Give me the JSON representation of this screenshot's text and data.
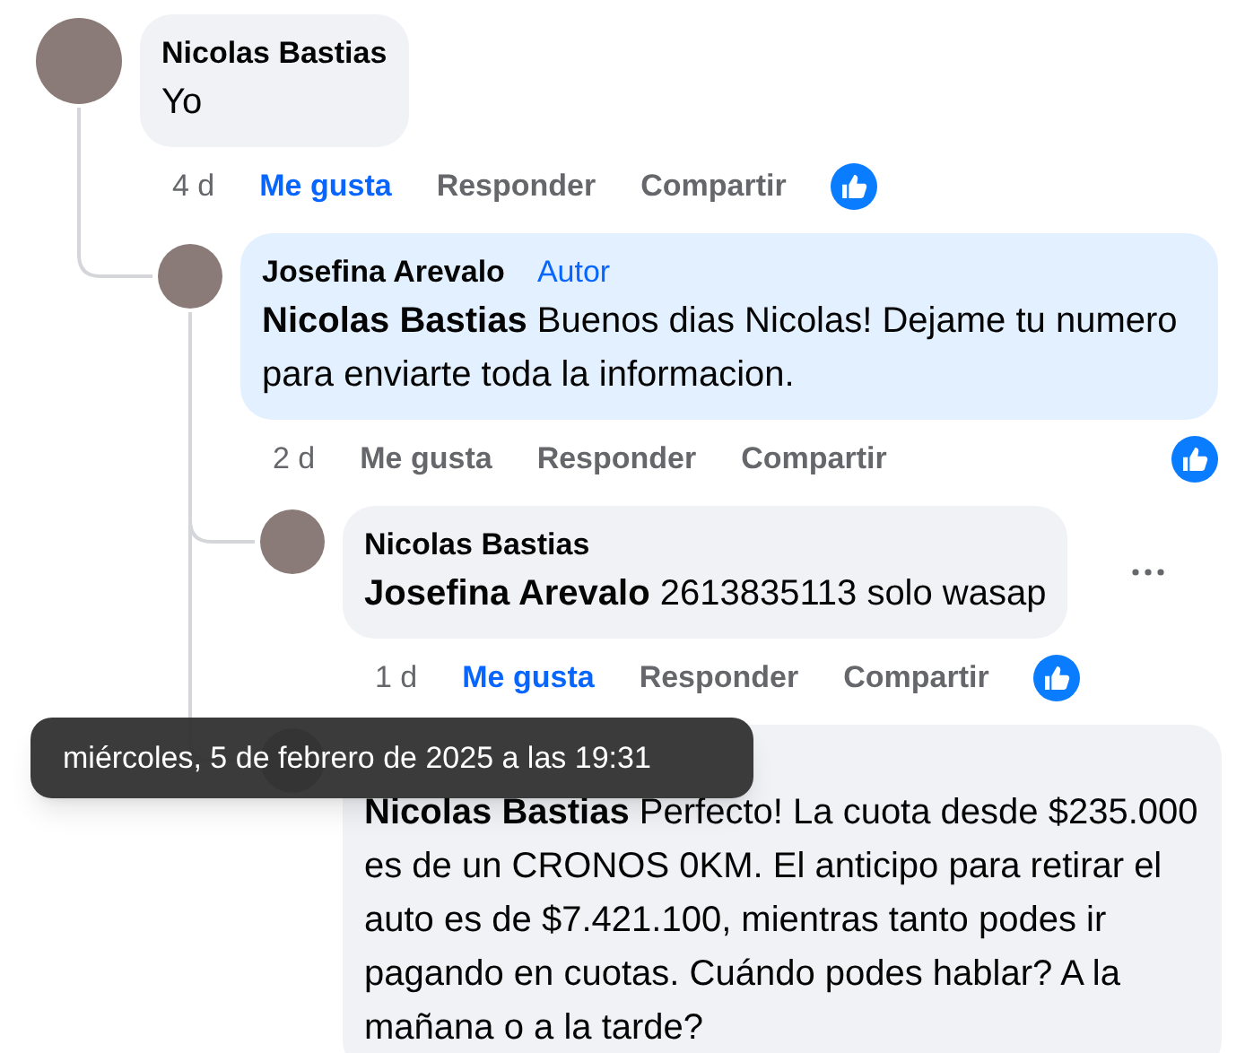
{
  "comments": [
    {
      "author": "Nicolas Bastias",
      "text": "Yo",
      "highlighted": false,
      "time": "4 d",
      "like": "Me gusta",
      "liked": true,
      "reply": "Responder",
      "share": "Compartir",
      "reacted": true,
      "children": [
        {
          "author": "Josefina Arevalo",
          "badge": "Autor",
          "text": "**Nicolas Bastias** Buenos dias Nicolas! Dejame tu numero para enviarte toda la informacion.",
          "highlighted": true,
          "time": "2 d",
          "like": "Me gusta",
          "liked": false,
          "reply": "Responder",
          "share": "Compartir",
          "reacted": true,
          "children": [
            {
              "author": "Nicolas Bastias",
              "text": "**Josefina Arevalo** 2613835113 solo wasap",
              "highlighted": false,
              "more": true,
              "time": "1 d",
              "like": "Me gusta",
              "liked": true,
              "reply": "Responder",
              "share": "Compartir",
              "reacted": true
            },
            {
              "text": "**Nicolas Bastias** Perfecto! La cuota desde $235.000 es de un CRONOS 0KM. El anticipo para retirar el auto es de $7.421.100, mientras tanto podes ir pagando en cuotas. Cuándo podes hablar? A la mañana o a la tarde?",
              "highlighted": false
            }
          ]
        }
      ]
    }
  ],
  "tooltip": {
    "text": "miércoles, 5 de febrero de 2025 a las 19:31"
  }
}
